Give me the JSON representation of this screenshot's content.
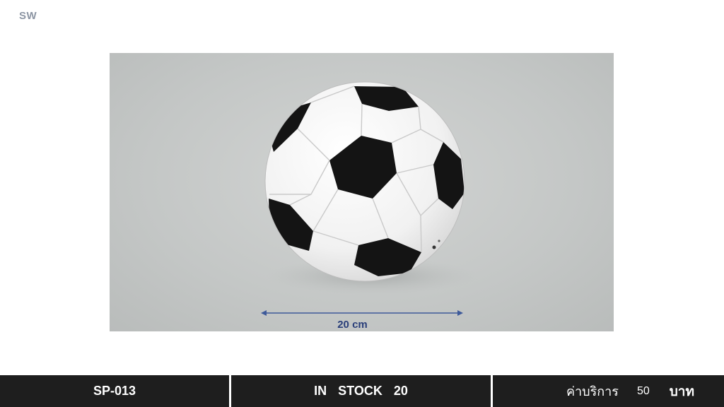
{
  "header": {
    "corner_label": "SW"
  },
  "product_image": {
    "subject": "soccer-ball",
    "dimension_label": "20 cm",
    "colors": {
      "background": "#c6c9c8",
      "ball_white": "#f7f7f7",
      "ball_black": "#141414",
      "arrow": "#3e5a9a"
    }
  },
  "footer": {
    "code": "SP-013",
    "stock_label": "IN  STOCK  20",
    "fee_label": "ค่าบริการ",
    "fee_value": "50",
    "fee_unit": "บาท"
  }
}
